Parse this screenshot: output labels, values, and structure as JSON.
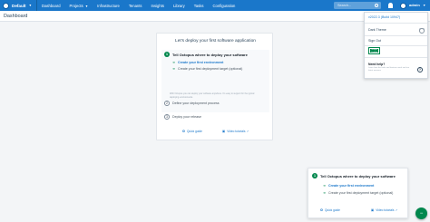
{
  "topnav": {
    "space_name": "Default",
    "links": [
      "Dashboard",
      "Projects",
      "Infrastructure",
      "Tenants",
      "Insights",
      "Library",
      "Tasks",
      "Configuration"
    ],
    "search_placeholder": "Search...",
    "user_name": "admin"
  },
  "page": {
    "title": "Dashboard"
  },
  "onboarding": {
    "title": "Let's deploy your first software application",
    "step1": {
      "number": "1",
      "title": "Tell Octopus where to deploy your software",
      "task1": "Create your first environment",
      "task2": "Create your first deployment target (optional)",
      "description": "With Octopus you can deploy your software anywhere. It's easy to support for the typical deploying environments."
    },
    "step2": {
      "number": "2",
      "title": "Define your deployment process"
    },
    "step3": {
      "number": "3",
      "title": "Deploy your release"
    },
    "footer": {
      "quick_guide": "Quick guide",
      "video_tutorials": "Video tutorials"
    }
  },
  "user_menu": {
    "version": "v2022.3 (Build 10947)",
    "dark_theme": "Dark Theme",
    "sign_out": "Sign Out",
    "badge_text": "Octopus Certified",
    "help_title": "Need help?",
    "help_desc": "Learn how the tools and features work and our latest answers"
  },
  "panel": {
    "number": "1",
    "title": "Tell Octopus where to deploy your software",
    "task1": "Create your first environment",
    "task2": "Create your first deployment target (optional)",
    "quick_guide": "Quick guide",
    "video_tutorials": "Video tutorials"
  },
  "colors": {
    "nav_blue": "#1a77ca",
    "green": "#00874d"
  }
}
